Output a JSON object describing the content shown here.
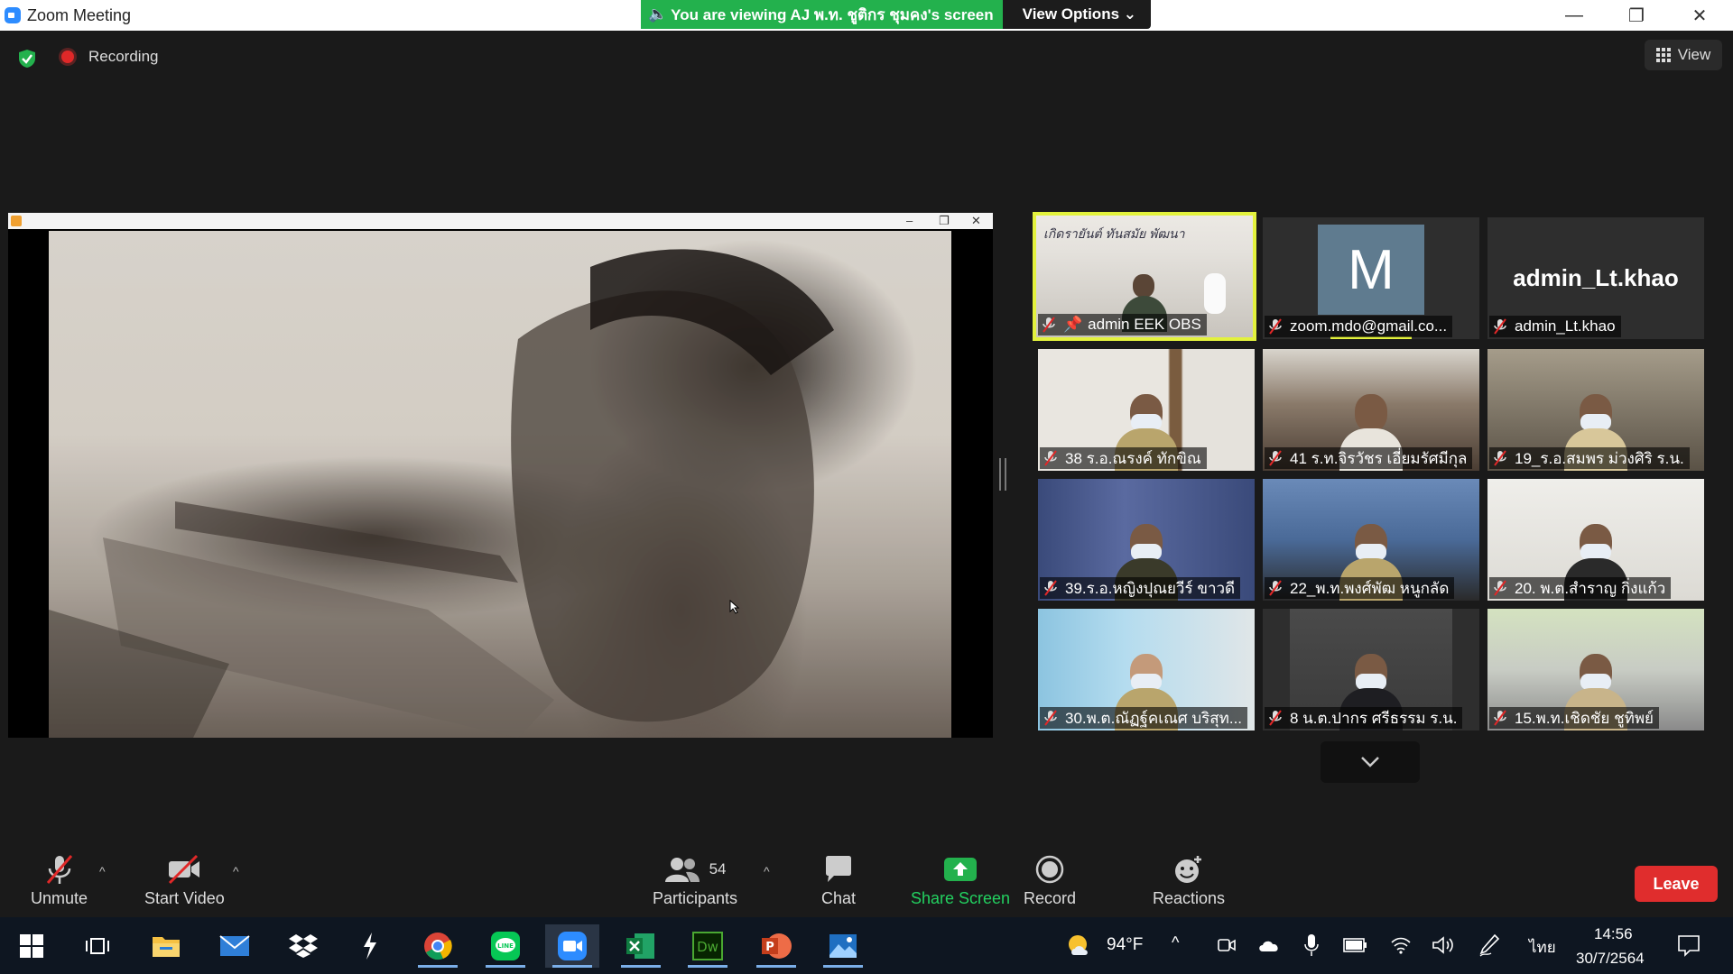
{
  "window": {
    "title": "Zoom Meeting",
    "minimize": "—",
    "restore": "❐",
    "close": "✕"
  },
  "banner": {
    "message": "You are viewing AJ พ.ท. ชูติกร  ชุมคง's screen",
    "view_options": "View Options ⌄"
  },
  "status": {
    "recording_label": "Recording",
    "view_label": "View"
  },
  "share_window_controls": [
    "–",
    "❐",
    "✕"
  ],
  "gallery": [
    {
      "name": "admin EEK OBS",
      "sign_text": "เกิดรายันต์   ทันสมัย   พัฒนา",
      "active": true
    },
    {
      "name": "zoom.mdo@gmail.co...",
      "initial": "M"
    },
    {
      "name": "admin_Lt.khao",
      "display_text": "admin_Lt.khao"
    },
    {
      "name": "38 ร.อ.ณรงค์ ทักขิณ"
    },
    {
      "name": "41 ร.ท.จิรวัชร เอี่ยมรัศมีกุล"
    },
    {
      "name": "19_ร.อ.สมพร  ม่วงศิริ ร.น."
    },
    {
      "name": "39.ร.อ.หญิงปุณยวีร์ ขาวดี"
    },
    {
      "name": "22_พ.ท.พงศ์พัฒ หนูกลัด"
    },
    {
      "name": "20. พ.ต.สำราญ  กิ่งแก้ว"
    },
    {
      "name": "30.พ.ต.ณัฏฐ์คเณศ บริสุท..."
    },
    {
      "name": "8 น.ต.ปากร ศรีธรรม ร.น."
    },
    {
      "name": "15.พ.ท.เชิดชัย ชูทิพย์"
    }
  ],
  "toolbar": {
    "unmute": "Unmute",
    "start_video": "Start Video",
    "participants": "Participants",
    "participants_count": "54",
    "chat": "Chat",
    "share_screen": "Share Screen",
    "record": "Record",
    "reactions": "Reactions",
    "leave": "Leave"
  },
  "taskbar": {
    "weather": "94°F",
    "language": "ไทย",
    "time": "14:56",
    "date": "30/7/2564"
  },
  "colors": {
    "accent_green": "#23b14d",
    "active_speaker": "#e3f23d",
    "leave_red": "#e02d2d",
    "muted_red": "#e02828"
  }
}
